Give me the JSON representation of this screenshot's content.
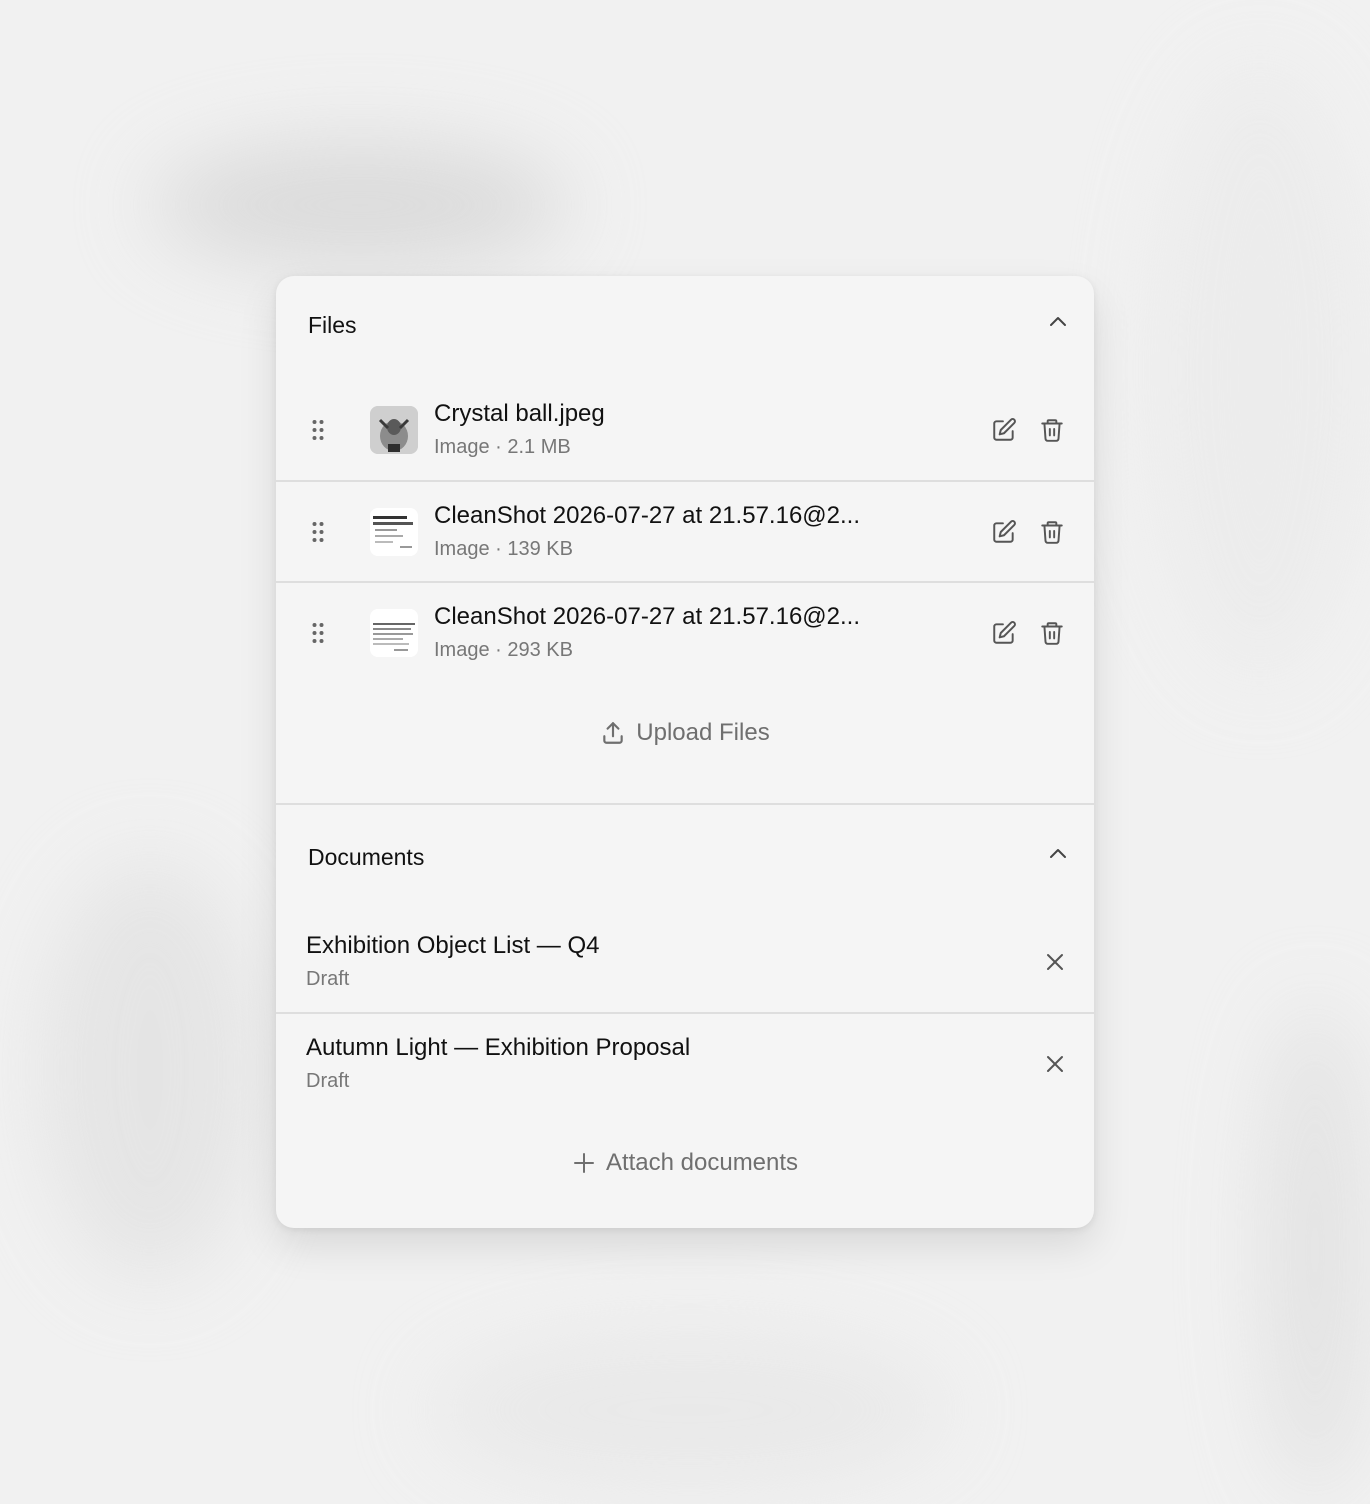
{
  "files_section": {
    "title": "Files",
    "items": [
      {
        "name": "Crystal ball.jpeg",
        "meta": "Image · 2.1 MB"
      },
      {
        "name": "CleanShot 2026-07-27 at 21.57.16@2...",
        "meta": "Image · 139 KB"
      },
      {
        "name": "CleanShot 2026-07-27 at 21.57.16@2...",
        "meta": "Image · 293 KB"
      }
    ],
    "upload_label": "Upload Files"
  },
  "documents_section": {
    "title": "Documents",
    "items": [
      {
        "title": "Exhibition Object List — Q4",
        "status": "Draft"
      },
      {
        "title": "Autumn Light — Exhibition Proposal",
        "status": "Draft"
      }
    ],
    "attach_label": "Attach documents"
  },
  "icons": {
    "collapse": "chevron-up-icon",
    "drag": "drag-handle-icon",
    "edit": "pencil-square-icon",
    "delete": "trash-icon",
    "upload": "upload-icon",
    "remove": "close-icon",
    "add": "plus-icon"
  },
  "colors": {
    "background": "#f1f1f1",
    "card": "#f5f5f5",
    "divider": "#dedede",
    "primary_text": "#111111",
    "secondary_text": "#777777",
    "icon": "#555555"
  }
}
